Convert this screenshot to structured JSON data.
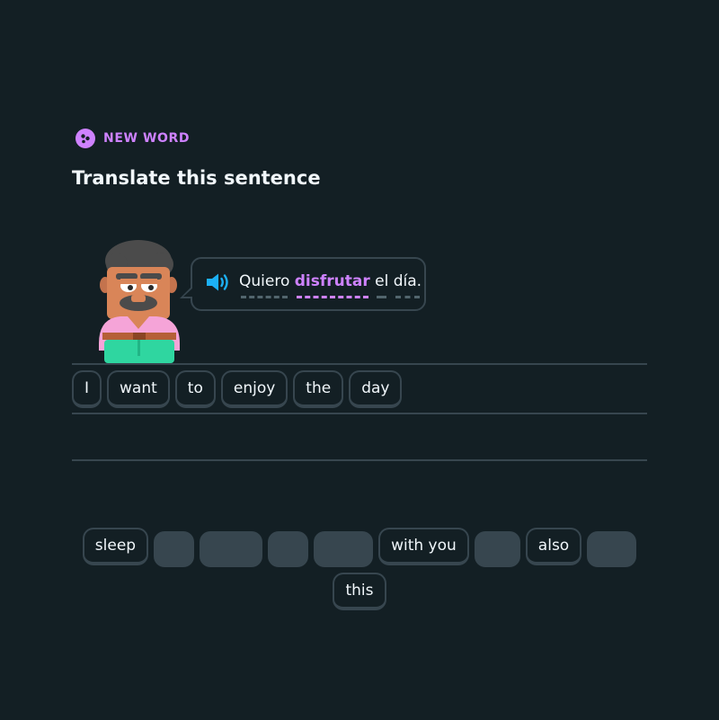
{
  "header": {
    "badge_label": "NEW WORD",
    "title": "Translate this sentence"
  },
  "prompt": {
    "words": [
      "Quiero",
      "disfrutar",
      "el",
      "día."
    ],
    "highlight_word": "disfrutar",
    "speaker_icon": "speaker-icon"
  },
  "answer_tiles": [
    "I",
    "want",
    "to",
    "enjoy",
    "the",
    "day"
  ],
  "word_bank": {
    "row1": [
      {
        "label": "sleep",
        "used": false
      },
      {
        "label": "",
        "used": true
      },
      {
        "label": "",
        "used": true
      },
      {
        "label": "",
        "used": true
      },
      {
        "label": "",
        "used": true
      },
      {
        "label": "with you",
        "used": false
      },
      {
        "label": "",
        "used": true
      },
      {
        "label": "also",
        "used": false
      },
      {
        "label": "",
        "used": true
      }
    ],
    "row2": [
      {
        "label": "this",
        "used": false
      }
    ]
  },
  "colors": {
    "background": "#131f24",
    "accent_purple": "#ce82ff",
    "speaker_blue": "#1cb0f6",
    "border": "#37464f",
    "text": "#f1f7fb"
  }
}
